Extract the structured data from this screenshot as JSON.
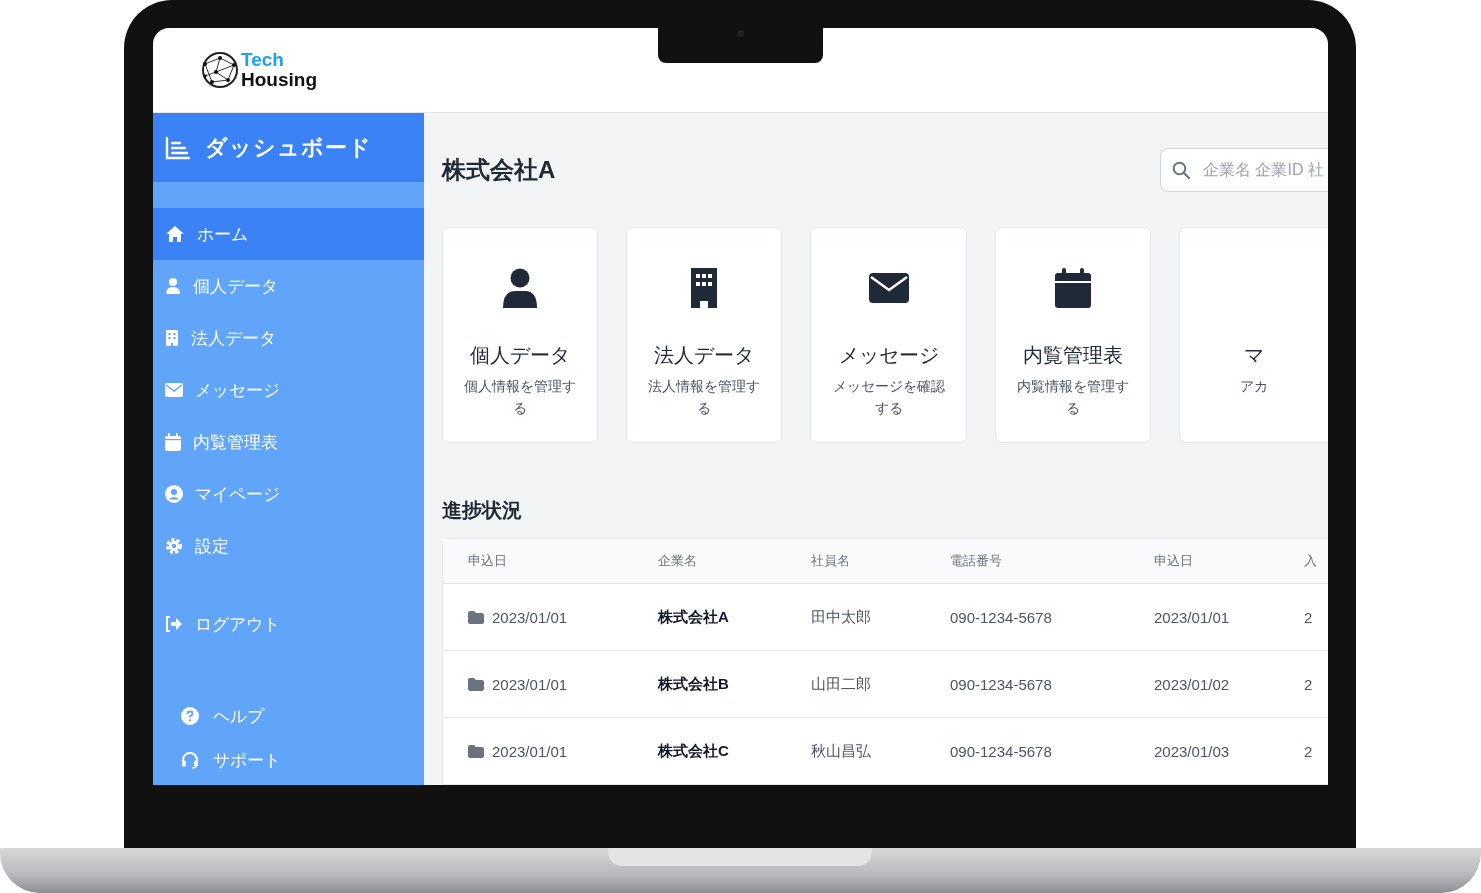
{
  "logo": {
    "line_1": "Tech",
    "line_2": "Housing"
  },
  "sidebar": {
    "title": "ダッシュボード",
    "items": [
      {
        "label": "ホーム",
        "selected": true
      },
      {
        "label": "個人データ",
        "selected": false
      },
      {
        "label": "法人データ",
        "selected": false
      },
      {
        "label": "メッセージ",
        "selected": false
      },
      {
        "label": "内覧管理表",
        "selected": false
      },
      {
        "label": "マイページ",
        "selected": false
      },
      {
        "label": "設定",
        "selected": false
      }
    ],
    "logout": "ログアウト",
    "footer_items": [
      "ヘルプ",
      "サポート"
    ]
  },
  "page_title": "株式会社A",
  "search": {
    "placeholder": "企業名 企業ID 社"
  },
  "cards": [
    {
      "title": "個人データ",
      "description": "個人情報を管理する"
    },
    {
      "title": "法人データ",
      "description": "法人情報を管理する"
    },
    {
      "title": "メッセージ",
      "description": "メッセージを確認する"
    },
    {
      "title": "内覧管理表",
      "description": "内覧情報を管理する"
    },
    {
      "title": "マ",
      "description": "アカ"
    }
  ],
  "section_title": "進捗状況",
  "table": {
    "columns": [
      "申込日",
      "企業名",
      "社員名",
      "電話番号",
      "申込日",
      "入"
    ],
    "rows": [
      [
        "2023/01/01",
        "株式会社A",
        "田中太郎",
        "090-1234-5678",
        "2023/01/01",
        "2"
      ],
      [
        "2023/01/01",
        "株式会社B",
        "山田二郎",
        "090-1234-5678",
        "2023/01/02",
        "2"
      ],
      [
        "2023/01/01",
        "株式会社C",
        "秋山昌弘",
        "090-1234-5678",
        "2023/01/03",
        "2"
      ]
    ]
  }
}
